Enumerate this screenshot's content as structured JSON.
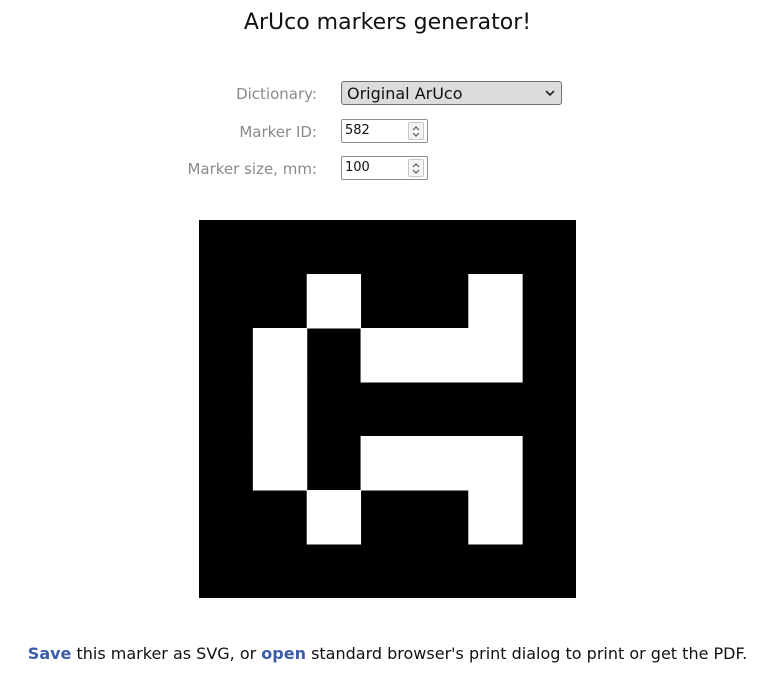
{
  "title": "ArUco markers generator!",
  "form": {
    "dictionary": {
      "label": "Dictionary:",
      "value": "Original ArUco"
    },
    "marker_id": {
      "label": "Marker ID:",
      "value": "582"
    },
    "marker_size": {
      "label": "Marker size, mm:",
      "value": "100"
    }
  },
  "marker": {
    "grid_size": 7,
    "foreground_color": "#000000",
    "background_color": "#ffffff",
    "bits": [
      [
        0,
        0,
        0,
        0,
        0,
        0,
        0
      ],
      [
        0,
        0,
        1,
        0,
        0,
        1,
        0
      ],
      [
        0,
        1,
        0,
        1,
        1,
        1,
        0
      ],
      [
        0,
        1,
        0,
        0,
        0,
        0,
        0
      ],
      [
        0,
        1,
        0,
        1,
        1,
        1,
        0
      ],
      [
        0,
        0,
        1,
        0,
        0,
        1,
        0
      ],
      [
        0,
        0,
        0,
        0,
        0,
        0,
        0
      ]
    ]
  },
  "footer": {
    "save_link": "Save",
    "text_1": " this marker as SVG, or ",
    "open_link": "open",
    "text_2": " standard browser's print dialog to print or get the PDF."
  },
  "colors": {
    "link": "#3b5bab",
    "label": "#8a8a8a"
  }
}
